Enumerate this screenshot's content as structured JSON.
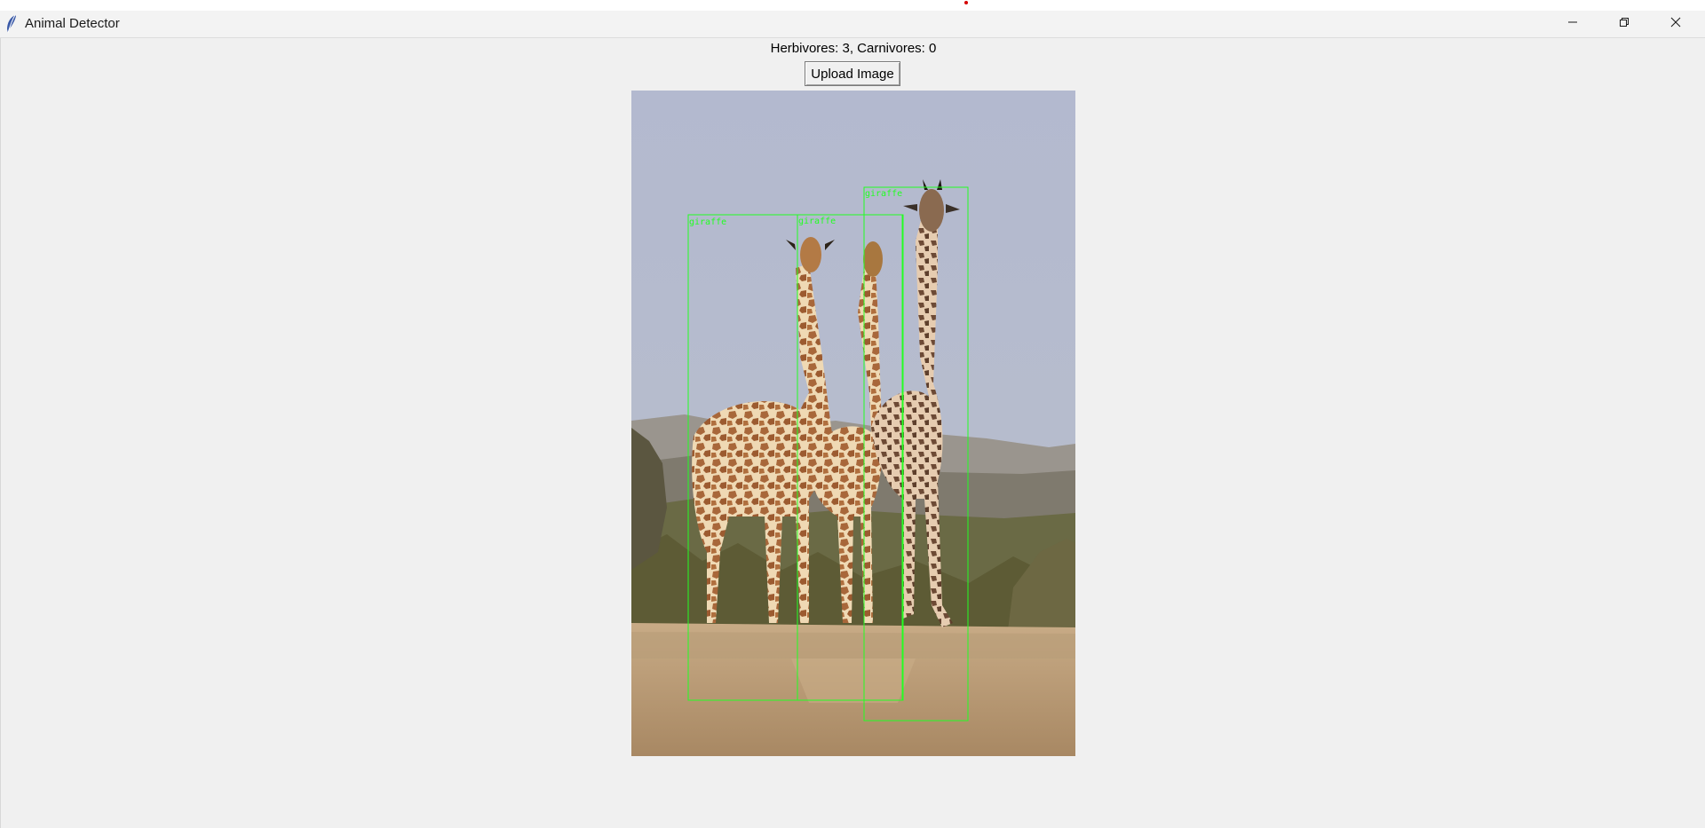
{
  "window": {
    "title": "Animal Detector",
    "controls": {
      "minimize": "minimize-icon",
      "restore": "restore-icon",
      "close": "close-icon"
    }
  },
  "status": {
    "text": "Herbivores: 3, Carnivores: 0"
  },
  "toolbar": {
    "upload_label": "Upload Image"
  },
  "detections": [
    {
      "label": "giraffe"
    },
    {
      "label": "giraffe"
    },
    {
      "label": "giraffe"
    }
  ],
  "colors": {
    "box": "#22ff22",
    "window_bg": "#f0f0f0"
  }
}
